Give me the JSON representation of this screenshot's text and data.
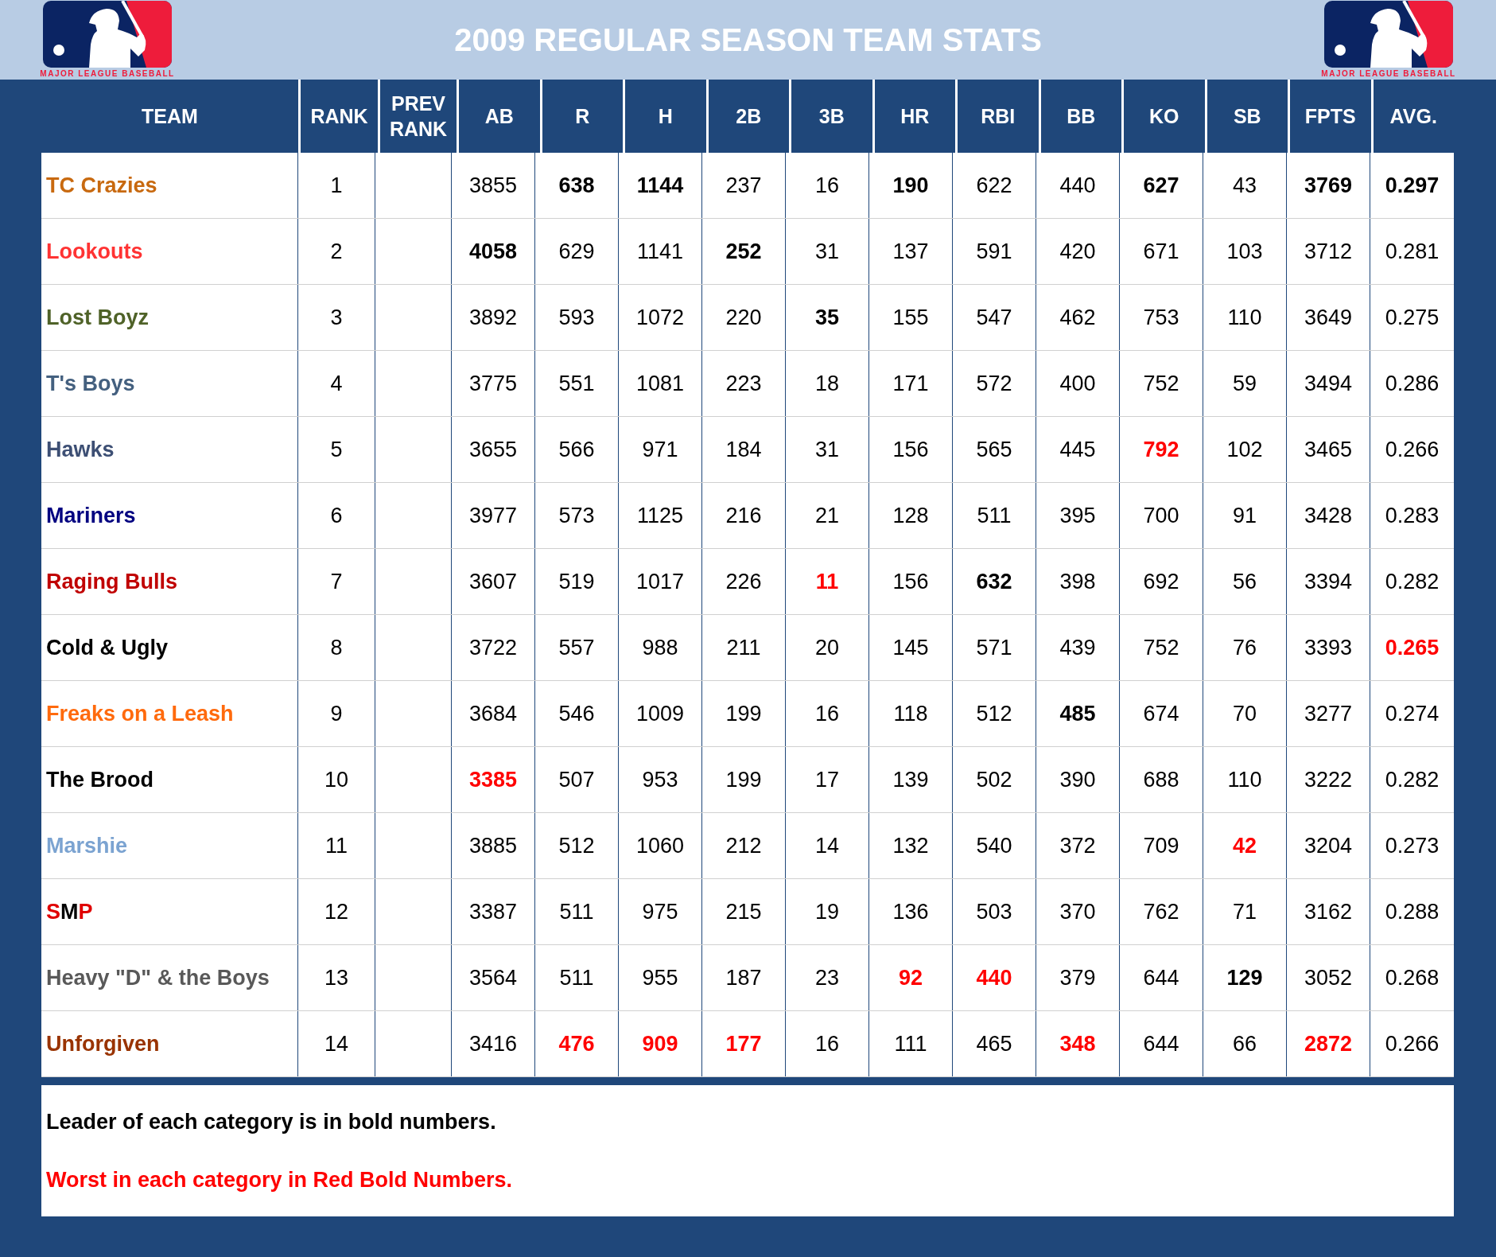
{
  "title": "2009 REGULAR SEASON TEAM STATS",
  "logos": [
    {
      "caption": "MAJOR LEAGUE BASEBALL"
    },
    {
      "caption": "MAJOR LEAGUE BASEBALL"
    }
  ],
  "columns": [
    "TEAM",
    "RANK",
    "PREV RANK",
    "AB",
    "R",
    "H",
    "2B",
    "3B",
    "HR",
    "RBI",
    "BB",
    "KO",
    "SB",
    "FPTS",
    "AVG."
  ],
  "rows": [
    {
      "team": [
        {
          "text": "TC Crazies",
          "color": "#c8690f"
        }
      ],
      "rank": "1",
      "stats": [
        {
          "value": "3855",
          "kind": "plain"
        },
        {
          "value": "638",
          "kind": "best"
        },
        {
          "value": "1144",
          "kind": "best"
        },
        {
          "value": "237",
          "kind": "plain"
        },
        {
          "value": "16",
          "kind": "plain"
        },
        {
          "value": "190",
          "kind": "best"
        },
        {
          "value": "622",
          "kind": "plain"
        },
        {
          "value": "440",
          "kind": "plain"
        },
        {
          "value": "627",
          "kind": "best"
        },
        {
          "value": "43",
          "kind": "plain"
        },
        {
          "value": "3769",
          "kind": "best"
        },
        {
          "value": "0.297",
          "kind": "best"
        }
      ]
    },
    {
      "team": [
        {
          "text": "Lookouts",
          "color": "#ff3333"
        }
      ],
      "rank": "2",
      "stats": [
        {
          "value": "4058",
          "kind": "best"
        },
        {
          "value": "629",
          "kind": "plain"
        },
        {
          "value": "1141",
          "kind": "plain"
        },
        {
          "value": "252",
          "kind": "best"
        },
        {
          "value": "31",
          "kind": "plain"
        },
        {
          "value": "137",
          "kind": "plain"
        },
        {
          "value": "591",
          "kind": "plain"
        },
        {
          "value": "420",
          "kind": "plain"
        },
        {
          "value": "671",
          "kind": "plain"
        },
        {
          "value": "103",
          "kind": "plain"
        },
        {
          "value": "3712",
          "kind": "plain"
        },
        {
          "value": "0.281",
          "kind": "plain"
        }
      ]
    },
    {
      "team": [
        {
          "text": "Lost Boyz",
          "color": "#4f6228"
        }
      ],
      "rank": "3",
      "stats": [
        {
          "value": "3892",
          "kind": "plain"
        },
        {
          "value": "593",
          "kind": "plain"
        },
        {
          "value": "1072",
          "kind": "plain"
        },
        {
          "value": "220",
          "kind": "plain"
        },
        {
          "value": "35",
          "kind": "best"
        },
        {
          "value": "155",
          "kind": "plain"
        },
        {
          "value": "547",
          "kind": "plain"
        },
        {
          "value": "462",
          "kind": "plain"
        },
        {
          "value": "753",
          "kind": "plain"
        },
        {
          "value": "110",
          "kind": "plain"
        },
        {
          "value": "3649",
          "kind": "plain"
        },
        {
          "value": "0.275",
          "kind": "plain"
        }
      ]
    },
    {
      "team": [
        {
          "text": "T's Boys",
          "color": "#44607f"
        }
      ],
      "rank": "4",
      "stats": [
        {
          "value": "3775",
          "kind": "plain"
        },
        {
          "value": "551",
          "kind": "plain"
        },
        {
          "value": "1081",
          "kind": "plain"
        },
        {
          "value": "223",
          "kind": "plain"
        },
        {
          "value": "18",
          "kind": "plain"
        },
        {
          "value": "171",
          "kind": "plain"
        },
        {
          "value": "572",
          "kind": "plain"
        },
        {
          "value": "400",
          "kind": "plain"
        },
        {
          "value": "752",
          "kind": "plain"
        },
        {
          "value": "59",
          "kind": "plain"
        },
        {
          "value": "3494",
          "kind": "plain"
        },
        {
          "value": "0.286",
          "kind": "plain"
        }
      ]
    },
    {
      "team": [
        {
          "text": "Hawks",
          "color": "#3d4f74"
        }
      ],
      "rank": "5",
      "stats": [
        {
          "value": "3655",
          "kind": "plain"
        },
        {
          "value": "566",
          "kind": "plain"
        },
        {
          "value": "971",
          "kind": "plain"
        },
        {
          "value": "184",
          "kind": "plain"
        },
        {
          "value": "31",
          "kind": "plain"
        },
        {
          "value": "156",
          "kind": "plain"
        },
        {
          "value": "565",
          "kind": "plain"
        },
        {
          "value": "445",
          "kind": "plain"
        },
        {
          "value": "792",
          "kind": "worst"
        },
        {
          "value": "102",
          "kind": "plain"
        },
        {
          "value": "3465",
          "kind": "plain"
        },
        {
          "value": "0.266",
          "kind": "plain"
        }
      ]
    },
    {
      "team": [
        {
          "text": "Mariners",
          "color": "#000080"
        }
      ],
      "rank": "6",
      "stats": [
        {
          "value": "3977",
          "kind": "plain"
        },
        {
          "value": "573",
          "kind": "plain"
        },
        {
          "value": "1125",
          "kind": "plain"
        },
        {
          "value": "216",
          "kind": "plain"
        },
        {
          "value": "21",
          "kind": "plain"
        },
        {
          "value": "128",
          "kind": "plain"
        },
        {
          "value": "511",
          "kind": "plain"
        },
        {
          "value": "395",
          "kind": "plain"
        },
        {
          "value": "700",
          "kind": "plain"
        },
        {
          "value": "91",
          "kind": "plain"
        },
        {
          "value": "3428",
          "kind": "plain"
        },
        {
          "value": "0.283",
          "kind": "plain"
        }
      ]
    },
    {
      "team": [
        {
          "text": "Raging Bulls",
          "color": "#c00000"
        }
      ],
      "rank": "7",
      "stats": [
        {
          "value": "3607",
          "kind": "plain"
        },
        {
          "value": "519",
          "kind": "plain"
        },
        {
          "value": "1017",
          "kind": "plain"
        },
        {
          "value": "226",
          "kind": "plain"
        },
        {
          "value": "11",
          "kind": "worst"
        },
        {
          "value": "156",
          "kind": "plain"
        },
        {
          "value": "632",
          "kind": "best"
        },
        {
          "value": "398",
          "kind": "plain"
        },
        {
          "value": "692",
          "kind": "plain"
        },
        {
          "value": "56",
          "kind": "plain"
        },
        {
          "value": "3394",
          "kind": "plain"
        },
        {
          "value": "0.282",
          "kind": "plain"
        }
      ]
    },
    {
      "team": [
        {
          "text": "Cold & Ugly",
          "color": "#000000"
        }
      ],
      "rank": "8",
      "stats": [
        {
          "value": "3722",
          "kind": "plain"
        },
        {
          "value": "557",
          "kind": "plain"
        },
        {
          "value": "988",
          "kind": "plain"
        },
        {
          "value": "211",
          "kind": "plain"
        },
        {
          "value": "20",
          "kind": "plain"
        },
        {
          "value": "145",
          "kind": "plain"
        },
        {
          "value": "571",
          "kind": "plain"
        },
        {
          "value": "439",
          "kind": "plain"
        },
        {
          "value": "752",
          "kind": "plain"
        },
        {
          "value": "76",
          "kind": "plain"
        },
        {
          "value": "3393",
          "kind": "plain"
        },
        {
          "value": "0.265",
          "kind": "worst"
        }
      ]
    },
    {
      "team": [
        {
          "text": "Freaks on a Leash",
          "color": "#ff6a0d"
        }
      ],
      "rank": "9",
      "stats": [
        {
          "value": "3684",
          "kind": "plain"
        },
        {
          "value": "546",
          "kind": "plain"
        },
        {
          "value": "1009",
          "kind": "plain"
        },
        {
          "value": "199",
          "kind": "plain"
        },
        {
          "value": "16",
          "kind": "plain"
        },
        {
          "value": "118",
          "kind": "plain"
        },
        {
          "value": "512",
          "kind": "plain"
        },
        {
          "value": "485",
          "kind": "best"
        },
        {
          "value": "674",
          "kind": "plain"
        },
        {
          "value": "70",
          "kind": "plain"
        },
        {
          "value": "3277",
          "kind": "plain"
        },
        {
          "value": "0.274",
          "kind": "plain"
        }
      ]
    },
    {
      "team": [
        {
          "text": "The Brood",
          "color": "#000000"
        }
      ],
      "rank": "10",
      "stats": [
        {
          "value": "3385",
          "kind": "worst"
        },
        {
          "value": "507",
          "kind": "plain"
        },
        {
          "value": "953",
          "kind": "plain"
        },
        {
          "value": "199",
          "kind": "plain"
        },
        {
          "value": "17",
          "kind": "plain"
        },
        {
          "value": "139",
          "kind": "plain"
        },
        {
          "value": "502",
          "kind": "plain"
        },
        {
          "value": "390",
          "kind": "plain"
        },
        {
          "value": "688",
          "kind": "plain"
        },
        {
          "value": "110",
          "kind": "plain"
        },
        {
          "value": "3222",
          "kind": "plain"
        },
        {
          "value": "0.282",
          "kind": "plain"
        }
      ]
    },
    {
      "team": [
        {
          "text": "Marshie",
          "color": "#7ba3d1"
        }
      ],
      "rank": "11",
      "stats": [
        {
          "value": "3885",
          "kind": "plain"
        },
        {
          "value": "512",
          "kind": "plain"
        },
        {
          "value": "1060",
          "kind": "plain"
        },
        {
          "value": "212",
          "kind": "plain"
        },
        {
          "value": "14",
          "kind": "plain"
        },
        {
          "value": "132",
          "kind": "plain"
        },
        {
          "value": "540",
          "kind": "plain"
        },
        {
          "value": "372",
          "kind": "plain"
        },
        {
          "value": "709",
          "kind": "plain"
        },
        {
          "value": "42",
          "kind": "worst"
        },
        {
          "value": "3204",
          "kind": "plain"
        },
        {
          "value": "0.273",
          "kind": "plain"
        }
      ]
    },
    {
      "team": [
        {
          "text": "S",
          "color": "#e00000"
        },
        {
          "text": "M",
          "color": "#000000"
        },
        {
          "text": "P",
          "color": "#e00000"
        }
      ],
      "rank": "12",
      "stats": [
        {
          "value": "3387",
          "kind": "plain"
        },
        {
          "value": "511",
          "kind": "plain"
        },
        {
          "value": "975",
          "kind": "plain"
        },
        {
          "value": "215",
          "kind": "plain"
        },
        {
          "value": "19",
          "kind": "plain"
        },
        {
          "value": "136",
          "kind": "plain"
        },
        {
          "value": "503",
          "kind": "plain"
        },
        {
          "value": "370",
          "kind": "plain"
        },
        {
          "value": "762",
          "kind": "plain"
        },
        {
          "value": "71",
          "kind": "plain"
        },
        {
          "value": "3162",
          "kind": "plain"
        },
        {
          "value": "0.288",
          "kind": "plain"
        }
      ]
    },
    {
      "team": [
        {
          "text": "Heavy \"D\" & the Boys",
          "color": "#595959"
        }
      ],
      "rank": "13",
      "stats": [
        {
          "value": "3564",
          "kind": "plain"
        },
        {
          "value": "511",
          "kind": "plain"
        },
        {
          "value": "955",
          "kind": "plain"
        },
        {
          "value": "187",
          "kind": "plain"
        },
        {
          "value": "23",
          "kind": "plain"
        },
        {
          "value": "92",
          "kind": "worst"
        },
        {
          "value": "440",
          "kind": "worst"
        },
        {
          "value": "379",
          "kind": "plain"
        },
        {
          "value": "644",
          "kind": "plain"
        },
        {
          "value": "129",
          "kind": "best"
        },
        {
          "value": "3052",
          "kind": "plain"
        },
        {
          "value": "0.268",
          "kind": "plain"
        }
      ]
    },
    {
      "team": [
        {
          "text": "Unforgiven",
          "color": "#993300"
        }
      ],
      "rank": "14",
      "stats": [
        {
          "value": "3416",
          "kind": "plain"
        },
        {
          "value": "476",
          "kind": "worst"
        },
        {
          "value": "909",
          "kind": "worst"
        },
        {
          "value": "177",
          "kind": "worst"
        },
        {
          "value": "16",
          "kind": "plain"
        },
        {
          "value": "111",
          "kind": "plain"
        },
        {
          "value": "465",
          "kind": "plain"
        },
        {
          "value": "348",
          "kind": "worst"
        },
        {
          "value": "644",
          "kind": "plain"
        },
        {
          "value": "66",
          "kind": "plain"
        },
        {
          "value": "2872",
          "kind": "worst"
        },
        {
          "value": "0.266",
          "kind": "plain"
        }
      ]
    }
  ],
  "notes": [
    {
      "text": "Leader of each category is in bold numbers.",
      "kind": "plain"
    },
    {
      "text": "Worst in each category in Red Bold Numbers.",
      "kind": "worst"
    }
  ]
}
